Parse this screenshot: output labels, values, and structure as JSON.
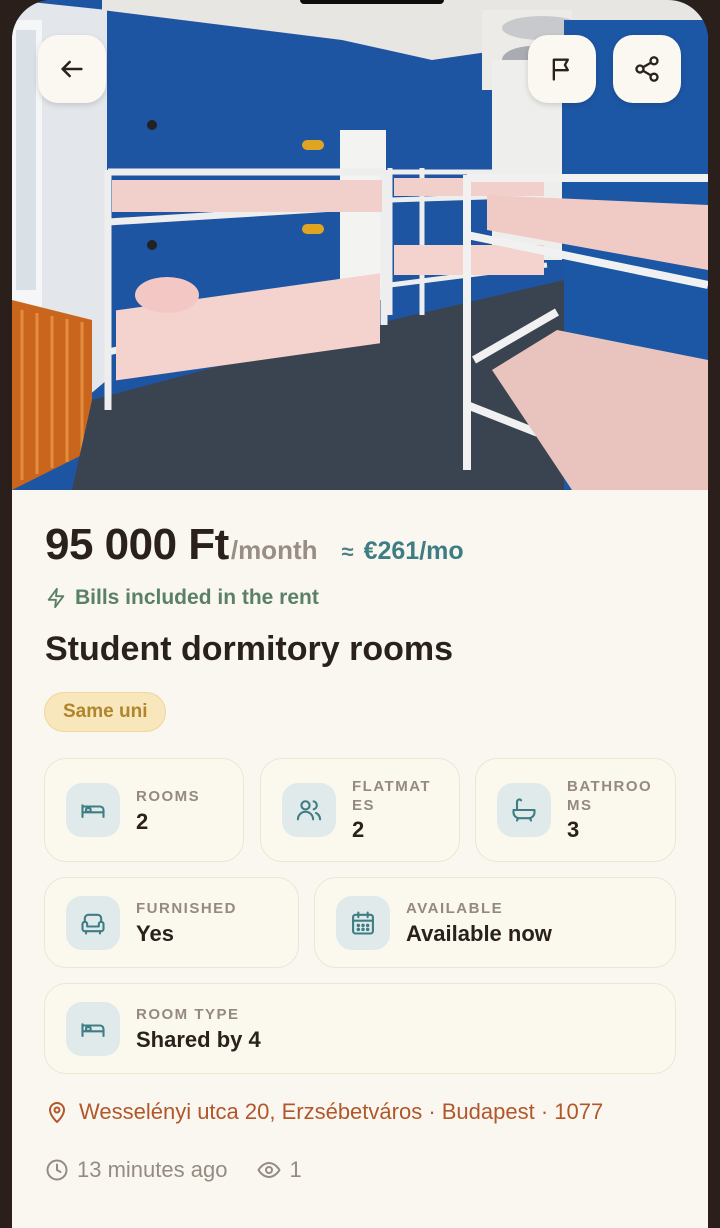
{
  "listing": {
    "price": "95 000 Ft",
    "period": "/month",
    "approx_symbol": "≈",
    "eur_price": "€261/mo",
    "bills_note": "Bills included in the rent",
    "title": "Student dormitory rooms",
    "badge": "Same uni"
  },
  "features": [
    {
      "label": "ROOMS",
      "value": "2",
      "icon": "bed-icon"
    },
    {
      "label": "FLATMAT\nES",
      "value": "2",
      "icon": "users-icon"
    },
    {
      "label": "BATHROO\nMS",
      "value": "3",
      "icon": "bath-icon"
    },
    {
      "label": "FURNISHED",
      "value": "Yes",
      "icon": "sofa-icon"
    },
    {
      "label": "AVAILABLE",
      "value": "Available now",
      "icon": "calendar-icon"
    },
    {
      "label": "ROOM TYPE",
      "value": "Shared by 4",
      "icon": "bed-icon"
    }
  ],
  "location": {
    "address": "Wesselényi utca 20, Erzsébetváros · Budapest · 1077"
  },
  "meta": {
    "posted": "13 minutes ago",
    "views": "1"
  },
  "actions": {
    "back_icon": "arrow-left-icon",
    "report_icon": "flag-icon",
    "share_icon": "share-icon"
  },
  "colors": {
    "accent_teal": "#3f7d84",
    "address": "#b2572a",
    "badge_bg": "#f8e6bc",
    "bills": "#5a8066"
  }
}
